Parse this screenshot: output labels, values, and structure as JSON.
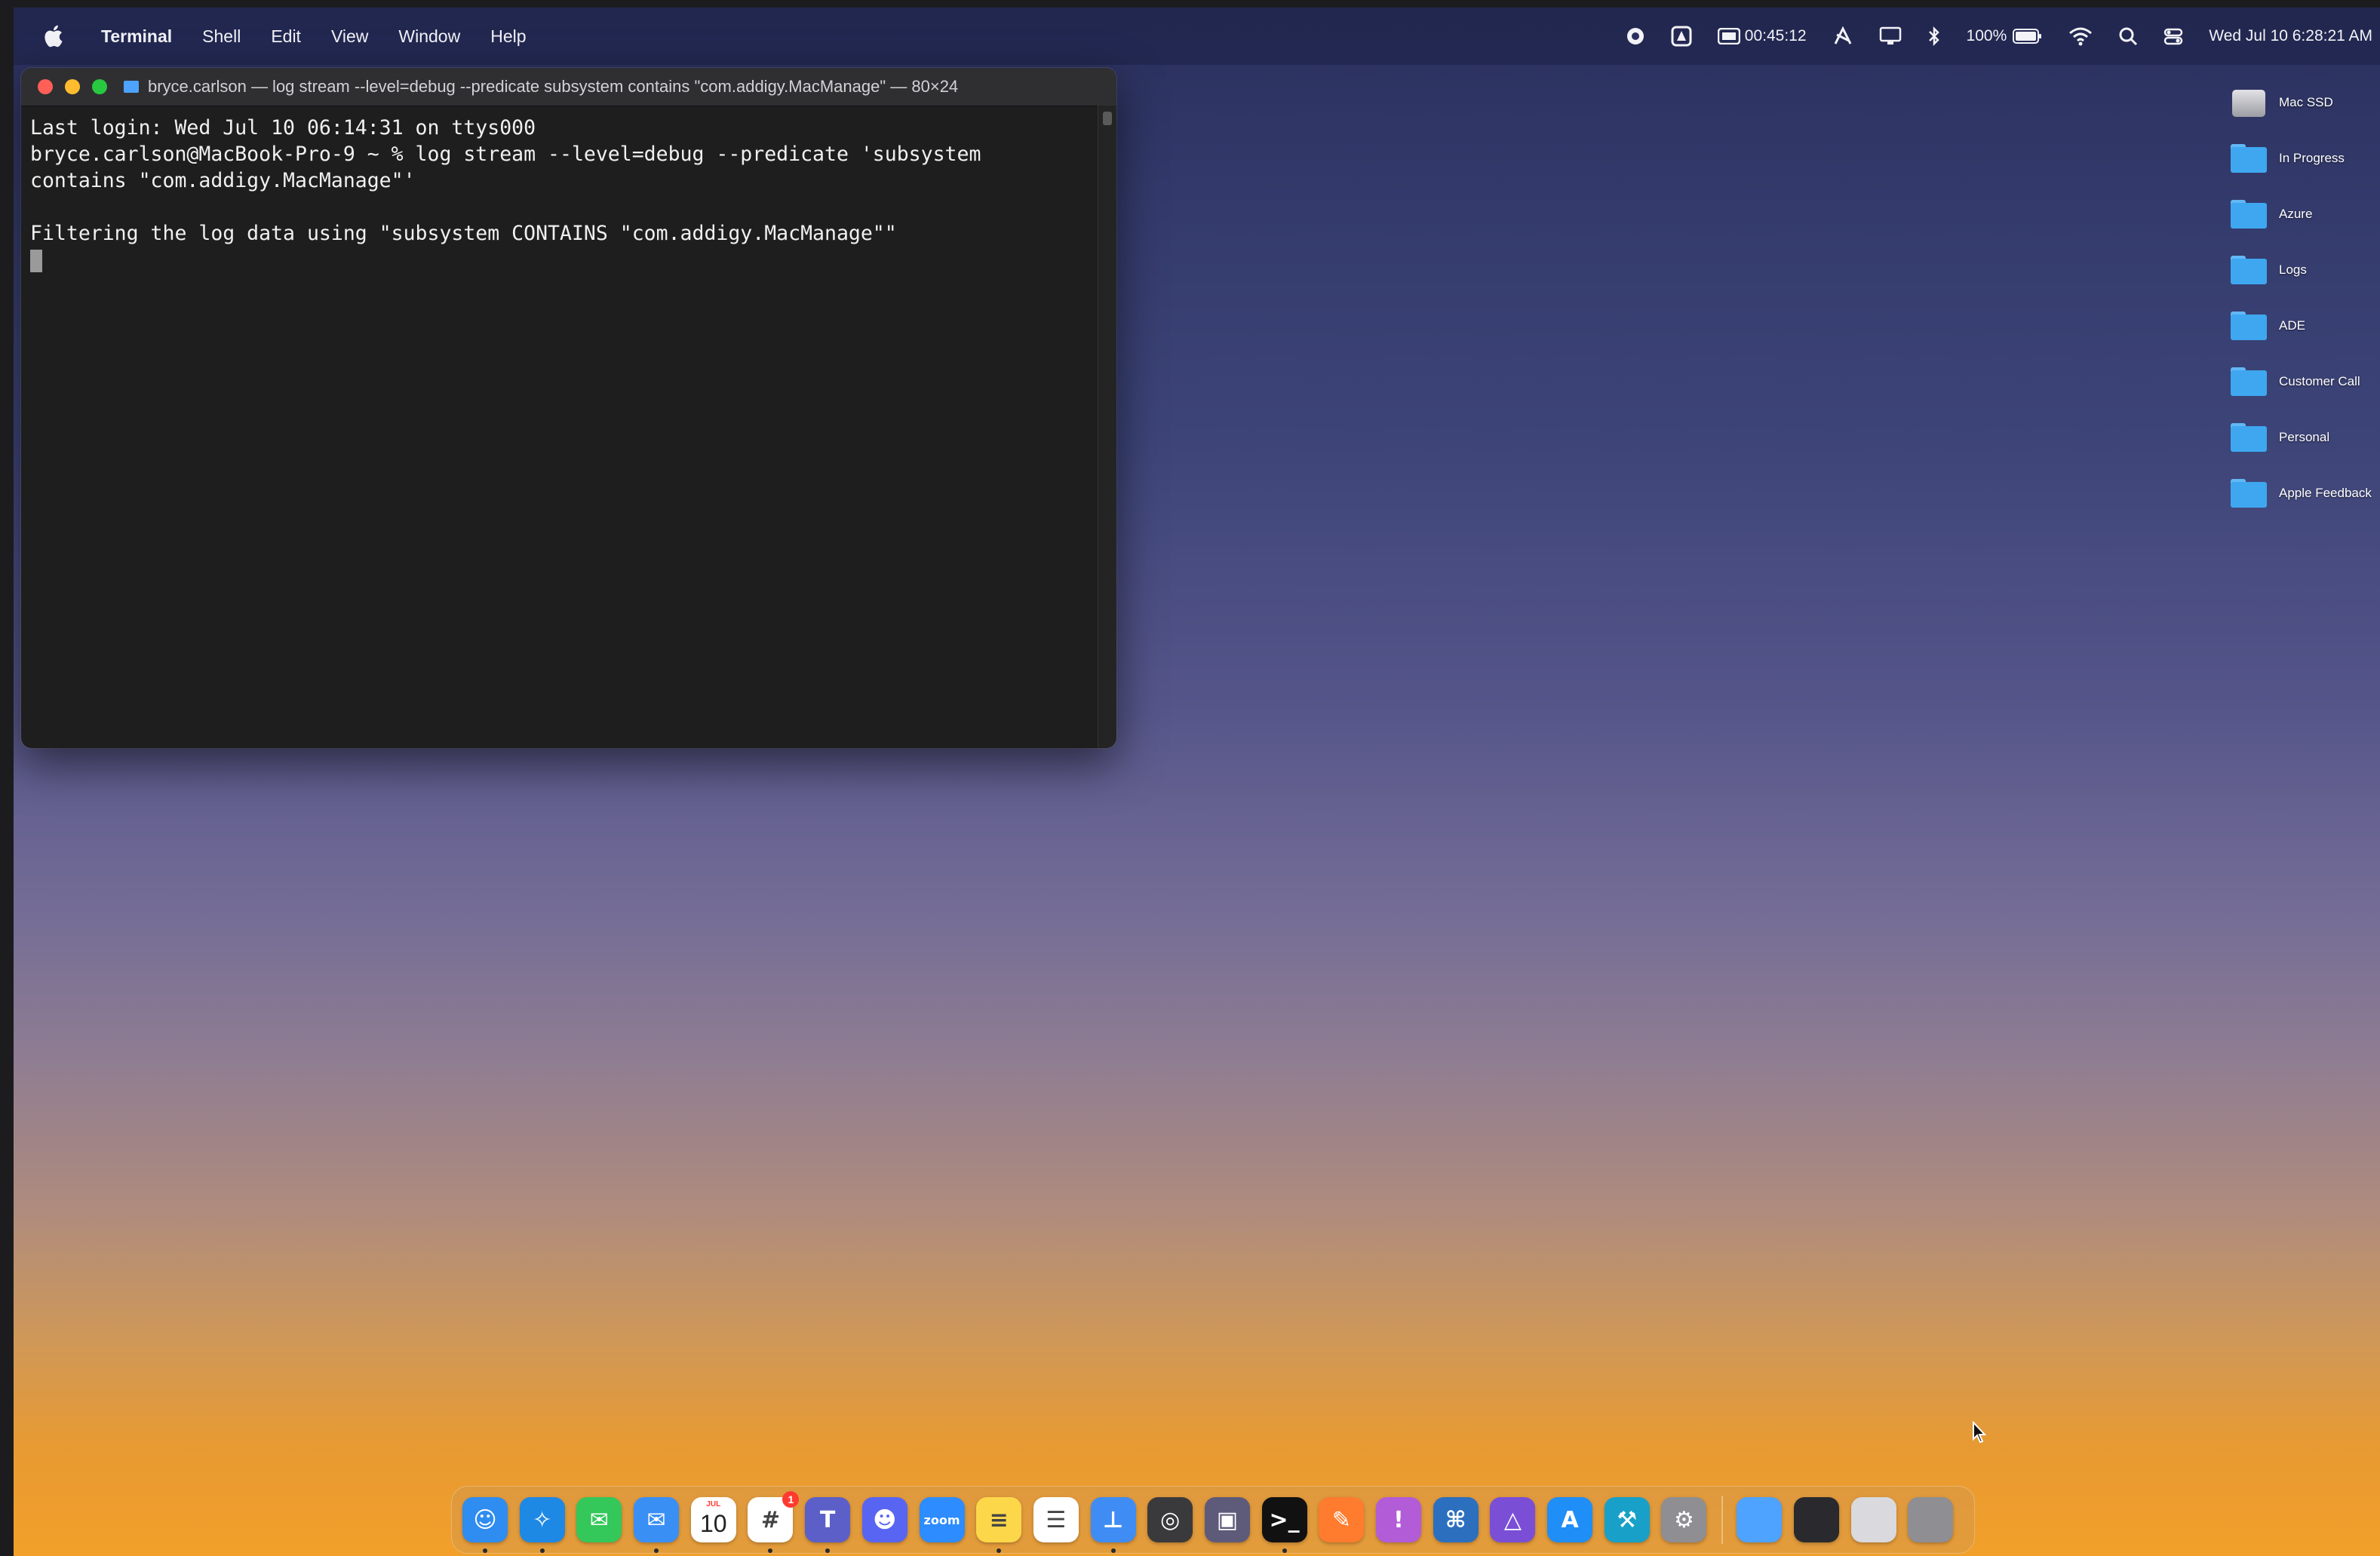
{
  "menubar": {
    "app_name": "Terminal",
    "menus": [
      "Shell",
      "Edit",
      "View",
      "Window",
      "Help"
    ],
    "status": {
      "timer": "00:45:12",
      "battery": "100%",
      "datetime": "Wed Jul 10  6:28:21 AM"
    }
  },
  "terminal": {
    "title": "bryce.carlson — log stream --level=debug --predicate subsystem contains \"com.addigy.MacManage\" — 80×24",
    "lines": [
      "Last login: Wed Jul 10 06:14:31 on ttys000",
      "bryce.carlson@MacBook-Pro-9 ~ % log stream --level=debug --predicate 'subsystem",
      "contains \"com.addigy.MacManage\"'",
      "",
      "Filtering the log data using \"subsystem CONTAINS \"com.addigy.MacManage\"\""
    ]
  },
  "desktop_icons": [
    {
      "label": "Mac SSD",
      "icon": "disk-icon"
    },
    {
      "label": "In Progress",
      "icon": "folder-icon"
    },
    {
      "label": "Azure",
      "icon": "folder-icon"
    },
    {
      "label": "Logs",
      "icon": "folder-icon"
    },
    {
      "label": "ADE",
      "icon": "folder-icon"
    },
    {
      "label": "Customer Call",
      "icon": "folder-icon"
    },
    {
      "label": "Personal",
      "icon": "folder-icon"
    },
    {
      "label": "Apple Feedback",
      "icon": "folder-icon"
    }
  ],
  "dock": {
    "apps": [
      {
        "name": "finder",
        "color": "#2f8cf0",
        "glyph": "☺",
        "running": true
      },
      {
        "name": "safari",
        "color": "#1e88e5",
        "glyph": "✧",
        "running": true
      },
      {
        "name": "messages",
        "color": "#34c759",
        "glyph": "✉",
        "running": false
      },
      {
        "name": "mail",
        "color": "#3a8ff5",
        "glyph": "✉",
        "running": true
      },
      {
        "name": "calendar",
        "color": "#ffffff",
        "glyph": "",
        "running": false,
        "calendar_day": "10",
        "calendar_month": "JUL"
      },
      {
        "name": "slack",
        "color": "#ffffff",
        "glyph": "#",
        "running": true,
        "badge": "1"
      },
      {
        "name": "teams",
        "color": "#5b5fc7",
        "glyph": "T",
        "running": true
      },
      {
        "name": "discord",
        "color": "#5865f2",
        "glyph": "☻",
        "running": false
      },
      {
        "name": "zoom",
        "color": "#2d8cff",
        "glyph": "zoom",
        "running": false
      },
      {
        "name": "notes",
        "color": "#fdd74a",
        "glyph": "≡",
        "running": true
      },
      {
        "name": "reminders",
        "color": "#ffffff",
        "glyph": "☰",
        "running": false
      },
      {
        "name": "keynote",
        "color": "#3f8cf5",
        "glyph": "⊥",
        "running": true
      },
      {
        "name": "quicktime",
        "color": "#3a3a3c",
        "glyph": "◎",
        "running": false
      },
      {
        "name": "screenshot",
        "color": "#5e5a7a",
        "glyph": "▣",
        "running": false
      },
      {
        "name": "terminal",
        "color": "#111111",
        "glyph": ">_",
        "running": true
      },
      {
        "name": "pencil",
        "color": "#ff7b2e",
        "glyph": "✎",
        "running": false
      },
      {
        "name": "feedback",
        "color": "#b25cd8",
        "glyph": "!",
        "running": false
      },
      {
        "name": "screen-share",
        "color": "#2c6fbf",
        "glyph": "⌘",
        "running": false
      },
      {
        "name": "apple-configurator",
        "color": "#7a4fd6",
        "glyph": "△",
        "running": false
      },
      {
        "name": "app-store",
        "color": "#1f8ef7",
        "glyph": "A",
        "running": false
      },
      {
        "name": "xcode",
        "color": "#18a0c8",
        "glyph": "⚒",
        "running": false
      },
      {
        "name": "system-settings",
        "color": "#8e8e93",
        "glyph": "⚙",
        "running": false
      }
    ],
    "stacks": [
      {
        "name": "downloads-stack",
        "color": "#4da3ff"
      },
      {
        "name": "screens-stack",
        "color": "#2a2a2e"
      },
      {
        "name": "documents-stack",
        "color": "#d9d9de"
      },
      {
        "name": "trash",
        "color": "#8e8e93"
      }
    ]
  }
}
